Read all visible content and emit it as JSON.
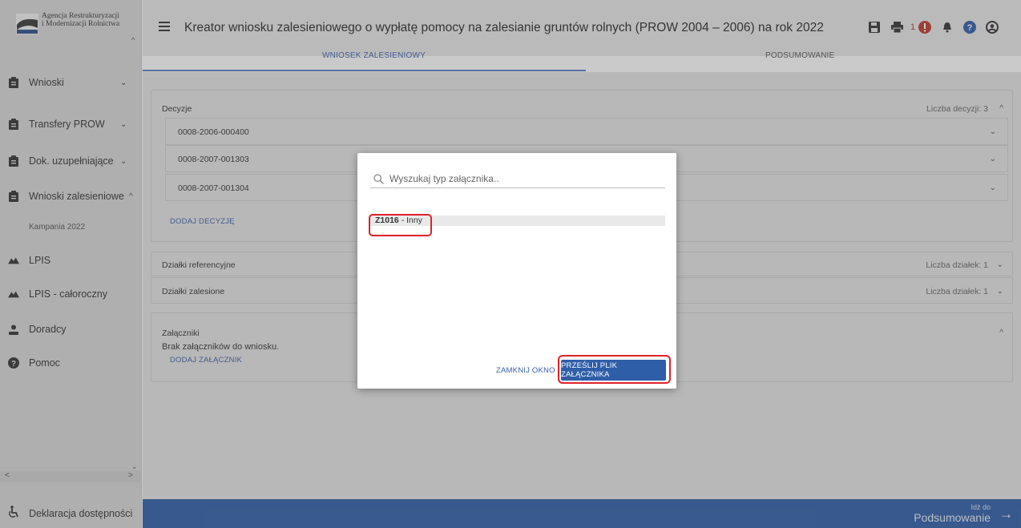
{
  "logo": {
    "line1": "Agencja Restrukturyzacji",
    "line2": "i Modernizacji Rolnictwa"
  },
  "sidebar": {
    "items": [
      {
        "label": "Wnioski",
        "icon": "clipboard-icon"
      },
      {
        "label": "Transfery PROW",
        "icon": "clipboard-icon"
      },
      {
        "label": "Dok. uzupełniające",
        "icon": "clipboard-icon"
      },
      {
        "label": "Wnioski zalesieniowe",
        "icon": "clipboard-icon"
      },
      {
        "label": "LPIS",
        "icon": "mountain-icon"
      },
      {
        "label": "LPIS - całoroczny",
        "icon": "mountain-icon"
      },
      {
        "label": "Doradcy",
        "icon": "person-icon"
      },
      {
        "label": "Pomoc",
        "icon": "help-icon"
      }
    ],
    "subitem": "Kampania 2022",
    "footer": "Deklaracja dostępności"
  },
  "header": {
    "title": "Kreator wniosku zalesieniowego o wypłatę pomocy na zalesianie gruntów rolnych (PROW 2004 – 2006) na rok 2022",
    "notification_count": "1",
    "tabs": [
      {
        "label": "WNIOSEK ZALESIENIOWY",
        "active": true
      },
      {
        "label": "PODSUMOWANIE",
        "active": false
      }
    ]
  },
  "decisions": {
    "title": "Decyzje",
    "count_label": "Liczba decyzji: 3",
    "rows": [
      "0008-2006-000400",
      "0008-2007-001303",
      "0008-2007-001304"
    ],
    "add_label": "DODAJ DECYZJĘ"
  },
  "ref_plots": {
    "title": "Działki referencyjne",
    "count_label": "Liczba działek: 1"
  },
  "forest_plots": {
    "title": "Działki zalesione",
    "count_label": "Liczba działek: 1"
  },
  "attachments": {
    "title": "Załączniki",
    "empty_text": "Brak załączników do wniosku.",
    "add_label": "DODAJ ZAŁĄCZNIK"
  },
  "footer_bar": {
    "small": "Idź do",
    "big": "Podsumowanie"
  },
  "dialog": {
    "search_placeholder": "Wyszukaj typ załącznika..",
    "result_code": "Z1016",
    "result_label": " - Inny",
    "close_label": "ZAMKNIJ OKNO",
    "send_label": "PRZEŚLIJ PLIK ZAŁĄCZNIKA"
  },
  "colors": {
    "primary": "#2f5ea8",
    "highlight": "#e0202a",
    "alert": "#c0392b",
    "link": "#3a5fae"
  }
}
